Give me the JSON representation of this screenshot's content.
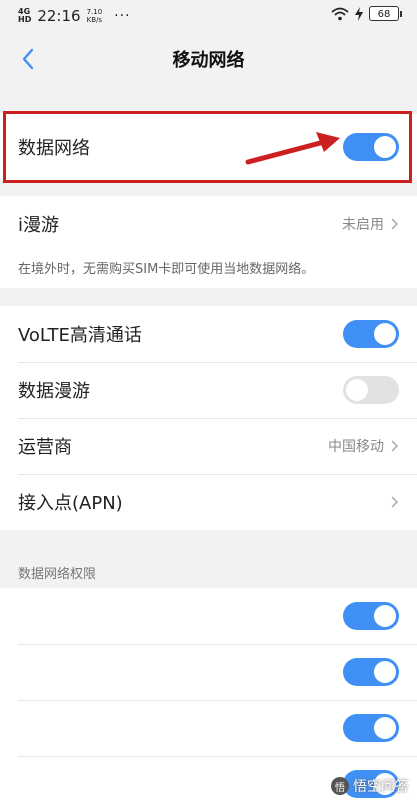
{
  "status_bar": {
    "signal": "4G\nHD",
    "time": "22:16",
    "speed": "7.10\nKB/s",
    "more": "···",
    "battery": "68",
    "icons": [
      "wifi-icon",
      "charging-icon",
      "battery-icon"
    ]
  },
  "header": {
    "title": "移动网络",
    "back_icon": "chevron-left-icon"
  },
  "data_network": {
    "label": "数据网络",
    "enabled": true
  },
  "roaming": {
    "label": "i漫游",
    "value": "未启用",
    "note": "在境外时，无需购买SIM卡即可使用当地数据网络。"
  },
  "settings": [
    {
      "label": "VoLTE高清通话",
      "type": "toggle",
      "enabled": true
    },
    {
      "label": "数据漫游",
      "type": "toggle",
      "enabled": false
    },
    {
      "label": "运营商",
      "type": "link",
      "value": "中国移动"
    },
    {
      "label": "接入点(APN)",
      "type": "link",
      "value": ""
    }
  ],
  "permissions": {
    "section_title": "数据网络权限",
    "toggles": [
      true,
      true,
      true,
      true
    ]
  },
  "watermark": "悟空问答",
  "colors": {
    "accent": "#3f8ff4",
    "highlight": "#cc1f1f",
    "background": "#f2f2f2"
  }
}
